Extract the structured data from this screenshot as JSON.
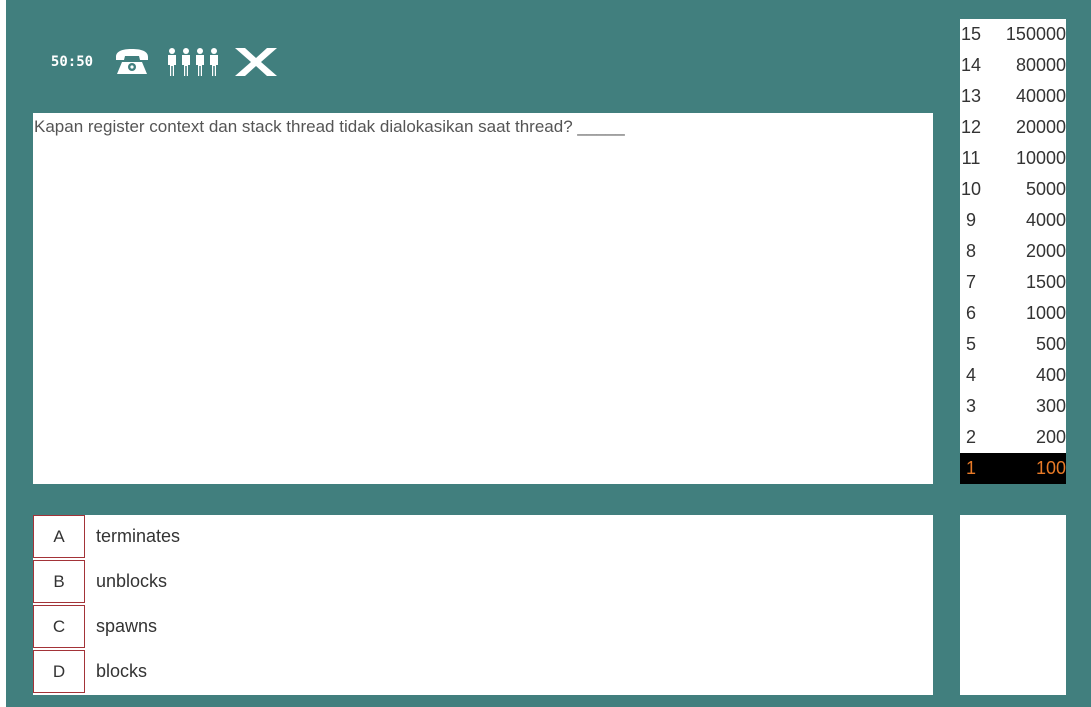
{
  "lifelines": {
    "fifty_fifty_label": "50:50",
    "phone_icon": "telephone-icon",
    "audience_icon": "audience-icon",
    "exit_icon": "close-icon"
  },
  "question": {
    "text": "Kapan register context dan stack thread tidak dialokasikan saat thread? _____"
  },
  "ladder": [
    {
      "level": "15",
      "amount": "150000"
    },
    {
      "level": "14",
      "amount": "80000"
    },
    {
      "level": "13",
      "amount": "40000"
    },
    {
      "level": "12",
      "amount": "20000"
    },
    {
      "level": "11",
      "amount": "10000"
    },
    {
      "level": "10",
      "amount": "5000"
    },
    {
      "level": "9",
      "amount": "4000"
    },
    {
      "level": "8",
      "amount": "2000"
    },
    {
      "level": "7",
      "amount": "1500"
    },
    {
      "level": "6",
      "amount": "1000"
    },
    {
      "level": "5",
      "amount": "500"
    },
    {
      "level": "4",
      "amount": "400"
    },
    {
      "level": "3",
      "amount": "300"
    },
    {
      "level": "2",
      "amount": "200"
    },
    {
      "level": "1",
      "amount": "100"
    }
  ],
  "current_level": "1",
  "answers": [
    {
      "letter": "A",
      "text": "terminates"
    },
    {
      "letter": "B",
      "text": "unblocks"
    },
    {
      "letter": "C",
      "text": "spawns"
    },
    {
      "letter": "D",
      "text": "blocks"
    }
  ],
  "colors": {
    "background": "#417f7e",
    "answer_border": "#a33338",
    "current_level_bg": "#000000",
    "current_level_text": "#e87a27"
  }
}
